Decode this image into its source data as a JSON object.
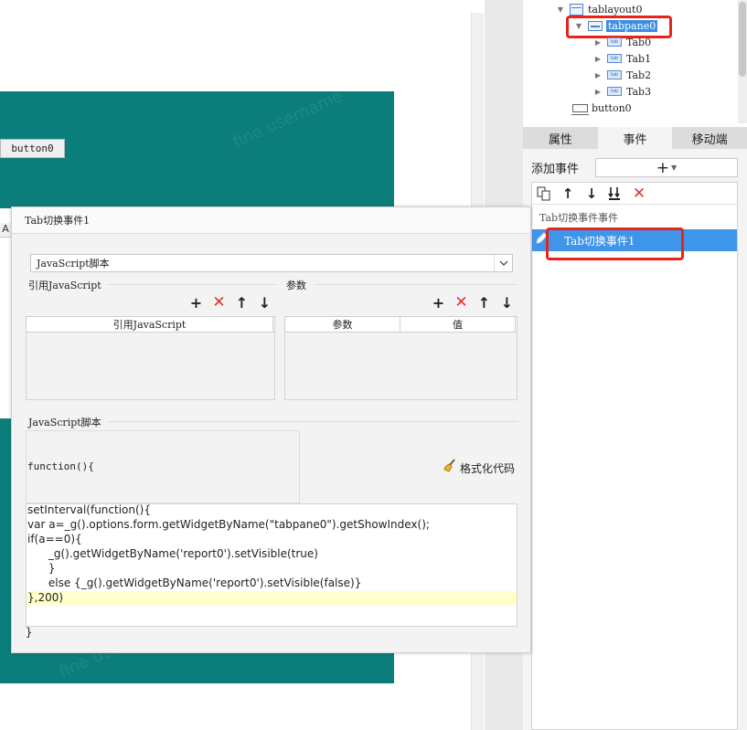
{
  "tree": {
    "items": [
      {
        "label": "tablayout0"
      },
      {
        "label": "tabpane0"
      },
      {
        "label": "Tab0",
        "icon_text": "tab"
      },
      {
        "label": "Tab1",
        "icon_text": "tab"
      },
      {
        "label": "Tab2",
        "icon_text": "tab"
      },
      {
        "label": "Tab3",
        "icon_text": "tab"
      },
      {
        "label": "button0"
      }
    ]
  },
  "tabs": [
    {
      "label": "属性"
    },
    {
      "label": "事件"
    },
    {
      "label": "移动端"
    }
  ],
  "events": {
    "add_label": "添加事件",
    "add_button": "+",
    "group_label": "Tab切换事件事件",
    "items": [
      {
        "label": "Tab切换事件1"
      }
    ]
  },
  "canvas": {
    "button_label": "button0",
    "column_header": "A"
  },
  "dialog": {
    "title": "Tab切换事件1",
    "type_select": "JavaScript脚本",
    "ref_js_section": "引用JavaScript",
    "ref_js_column": "引用JavaScript",
    "params_section": "参数",
    "params_columns": [
      "参数",
      "值"
    ],
    "script_section": "JavaScript脚本",
    "function_header": "function(){",
    "format_button": "格式化代码",
    "function_close": "}",
    "code_lines": [
      "setInterval(function(){",
      "var a=_g().options.form.getWidgetByName(\"tabpane0\").getShowIndex();",
      "if(a==0){",
      "      _g().getWidgetByName('report0').setVisible(true)",
      "      }",
      "      else {_g().getWidgetByName('report0').setVisible(false)}",
      "},200)"
    ]
  },
  "colors": {
    "teal": "#0b7e7b",
    "accent_blue": "#3f95ea",
    "highlight_red": "#e8241a",
    "delete_red": "#e0322a"
  }
}
